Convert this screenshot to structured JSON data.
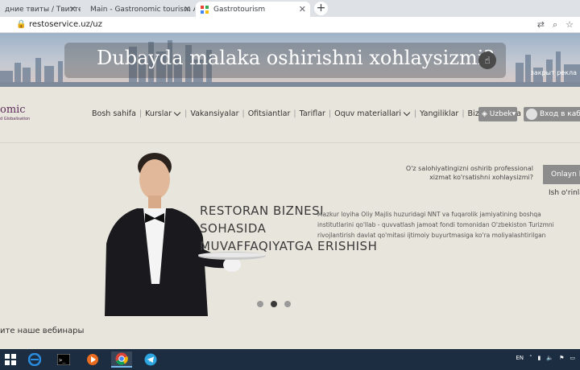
{
  "browser": {
    "tabs": [
      {
        "title": "дние твиты / Твиттер",
        "active": false
      },
      {
        "title": "Main - Gastronomic tourism Ass",
        "active": false
      },
      {
        "title": "Gastrotourism",
        "active": true
      }
    ],
    "new_tab_label": "+",
    "url": "restoservice.uz/uz"
  },
  "banner": {
    "text": "Dubayda malaka oshirishni xohlaysizmi?",
    "corner_text": "закрыт рекла"
  },
  "header": {
    "logo_text": "omic",
    "logo_subtext": "d Globalisation",
    "nav": [
      {
        "label": "Bosh sahifa",
        "dropdown": false
      },
      {
        "label": "Kurslar",
        "dropdown": true
      },
      {
        "label": "Vakansiyalar",
        "dropdown": false
      },
      {
        "label": "Ofitsiantlar",
        "dropdown": false
      },
      {
        "label": "Tariflar",
        "dropdown": false
      },
      {
        "label": "Oquv materiallari",
        "dropdown": true
      },
      {
        "label": "Yangiliklar",
        "dropdown": false
      },
      {
        "label": "Biz haqimizda",
        "dropdown": false
      }
    ],
    "language": "Uzbek",
    "login": "Вход в каби"
  },
  "hero": {
    "title_lines": [
      "RESTORAN BIZNESI",
      "SOHASIDA",
      "MUVAFFAQIYATGA ERISHISH"
    ],
    "description": "Mazkur loyiha Oliy Majlis huzuridagi NNT va fuqarolik jamiyatining boshqa institutlarini qo'llab - quvvatlash jamoat fondi tomonidan O'zbekiston Turizmni rivojlantirish davlat qo'mitasi ijtimoiy buyurtmasiga ko'ra moliyalashtirilgan",
    "cta_question": "O'z salohiyatingizni oshirib professional xizmat ko'rsatishni xohlaysizmi?",
    "cta_button": "Onlayn k",
    "cta_sub": "Ish o'rinla"
  },
  "webinars": {
    "title": "ите наше вебинары"
  },
  "taskbar": {
    "lang": "EN"
  },
  "colors": {
    "nav_button": "#8c8c8c",
    "page_bg": "#e8e6dc",
    "taskbar": "#1c2d41"
  }
}
